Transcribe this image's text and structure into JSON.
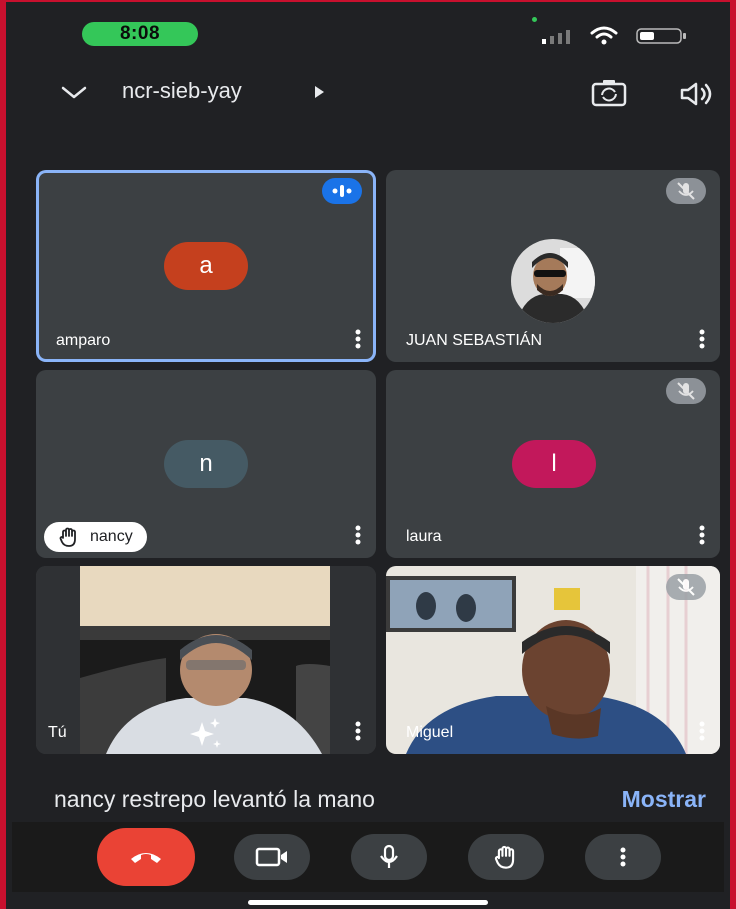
{
  "status_bar": {
    "time": "8:08"
  },
  "header": {
    "meeting_code": "ncr-sieb-yay"
  },
  "tiles": [
    {
      "name": "amparo",
      "initial": "a",
      "avatar_color": "#c5401e",
      "speaking": true
    },
    {
      "name": "JUAN SEBASTIÁN",
      "muted": true
    },
    {
      "name": "nancy",
      "initial": "n",
      "avatar_color": "#455a64",
      "hand_raised": true
    },
    {
      "name": "laura",
      "initial": "l",
      "avatar_color": "#c2185b",
      "muted": true
    },
    {
      "name": "Tú"
    },
    {
      "name": "Miguel",
      "muted": true
    }
  ],
  "notification": {
    "text": "nancy restrepo levantó la mano",
    "action": "Mostrar"
  },
  "colors": {
    "accent": "#8ab4f8",
    "end_call": "#ea4335",
    "time_pill": "#34c759"
  },
  "icons": {
    "controls": [
      "end-call-icon",
      "camera-icon",
      "microphone-icon",
      "raise-hand-icon",
      "more-options-icon"
    ]
  }
}
